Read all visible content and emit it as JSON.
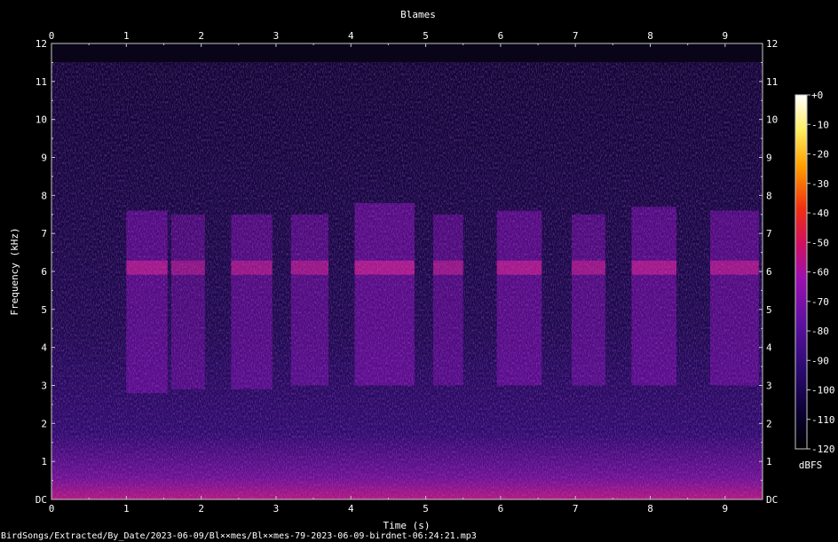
{
  "chart_data": {
    "type": "heatmap",
    "title": "Blames",
    "xlabel": "Time (s)",
    "ylabel": "Frequency (kHz)",
    "xlim": [
      0,
      9.5
    ],
    "ylim": [
      0,
      12
    ],
    "x_ticks": [
      "0",
      "1",
      "2",
      "3",
      "4",
      "5",
      "6",
      "7",
      "8",
      "9"
    ],
    "y_ticks": [
      "DC",
      "1",
      "2",
      "3",
      "4",
      "5",
      "6",
      "7",
      "8",
      "9",
      "10",
      "11",
      "12"
    ],
    "colorbar": {
      "label": "dBFS",
      "range": [
        -120,
        0
      ],
      "ticks": [
        "+0",
        "-10",
        "-20",
        "-30",
        "-40",
        "-50",
        "-60",
        "-70",
        "-80",
        "-90",
        "-100",
        "-110",
        "-120"
      ],
      "colors": [
        "#000000",
        "#0a0030",
        "#2a0a6e",
        "#5a10a0",
        "#9a10b0",
        "#d01060",
        "#f03010",
        "#ffa000",
        "#ffee60",
        "#ffffff"
      ]
    },
    "energy_bands": [
      {
        "t0": 1.0,
        "t1": 1.55,
        "f0": 2.8,
        "f1": 7.6,
        "level": 0.65
      },
      {
        "t0": 1.6,
        "t1": 2.05,
        "f0": 2.9,
        "f1": 7.5,
        "level": 0.4
      },
      {
        "t0": 2.4,
        "t1": 2.95,
        "f0": 2.9,
        "f1": 7.5,
        "level": 0.55
      },
      {
        "t0": 3.2,
        "t1": 3.7,
        "f0": 3.0,
        "f1": 7.5,
        "level": 0.55
      },
      {
        "t0": 4.05,
        "t1": 4.85,
        "f0": 3.0,
        "f1": 7.8,
        "level": 0.75
      },
      {
        "t0": 5.1,
        "t1": 5.5,
        "f0": 3.0,
        "f1": 7.5,
        "level": 0.5
      },
      {
        "t0": 5.95,
        "t1": 6.55,
        "f0": 3.0,
        "f1": 7.6,
        "level": 0.7
      },
      {
        "t0": 6.95,
        "t1": 7.4,
        "f0": 3.0,
        "f1": 7.5,
        "level": 0.55
      },
      {
        "t0": 7.75,
        "t1": 8.35,
        "f0": 3.0,
        "f1": 7.7,
        "level": 0.65
      },
      {
        "t0": 8.8,
        "t1": 9.45,
        "f0": 3.0,
        "f1": 7.6,
        "level": 0.6
      }
    ]
  },
  "footer": {
    "path": "BirdSongs/Extracted/By_Date/2023-06-09/Bl××mes/Bl××mes-79-2023-06-09-birdnet-06:24:21.mp3"
  }
}
